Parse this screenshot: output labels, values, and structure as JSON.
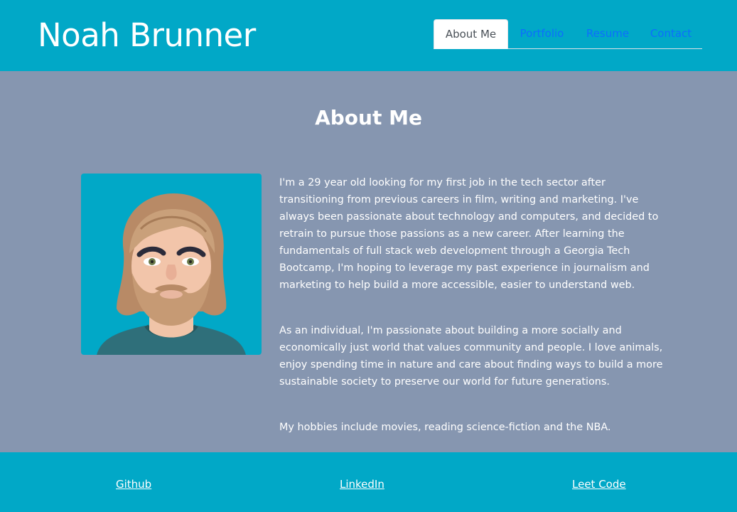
{
  "header": {
    "title": "Noah Brunner",
    "tabs": [
      {
        "label": "About Me",
        "active": true
      },
      {
        "label": "Portfolio",
        "active": false
      },
      {
        "label": "Resume",
        "active": false
      },
      {
        "label": "Contact",
        "active": false
      }
    ]
  },
  "main": {
    "heading": "About Me",
    "avatar_icon": "cartoon-avatar-portrait",
    "paragraphs": [
      "I'm a 29 year old looking for my first job in the tech sector after transitioning from previous careers in film, writing and marketing. I've always been passionate about technology and computers, and decided to retrain to pursue those passions as a new career. After learning the fundamentals of full stack web development through a Georgia Tech Bootcamp, I'm hoping to leverage my past experience in journalism and marketing to help build a more accessible, easier to understand web.",
      "As an individual, I'm passionate about building a more socially and economically just world that values community and people. I love animals, enjoy spending time in nature and care about finding ways to build a more sustainable society to preserve our world for future generations.",
      "My hobbies include movies, reading science-fiction and the NBA."
    ]
  },
  "footer": {
    "links": [
      {
        "label": "Github"
      },
      {
        "label": "LinkedIn"
      },
      {
        "label": "Leet Code"
      }
    ]
  },
  "colors": {
    "header_bg": "#01a8c7",
    "page_bg": "#8696b0",
    "tab_link": "#0d6efd",
    "active_tab_text": "#495057"
  }
}
